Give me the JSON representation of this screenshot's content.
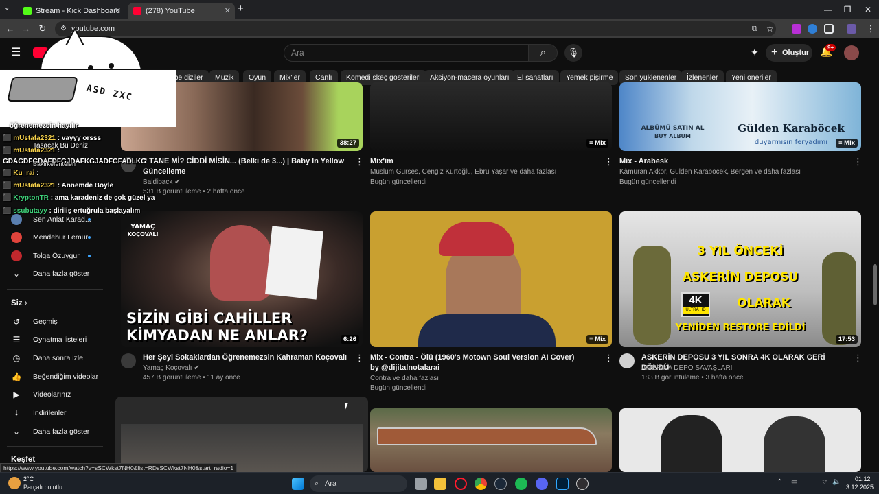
{
  "browser": {
    "tabs": [
      {
        "title": "Stream - Kick Dashboard",
        "favicon_color": "#53fc18"
      },
      {
        "title": "(278) YouTube",
        "favicon_color": "#ff0033"
      }
    ],
    "url": "youtube.com",
    "new_tab_label": "+"
  },
  "youtube": {
    "search_placeholder": "Ara",
    "create_label": "Oluştur",
    "notification_badge": "9+",
    "chips": [
      "Pembe diziler",
      "Müzik",
      "Oyun",
      "Mix'ler",
      "Canlı",
      "Komedi skeç gösterileri",
      "Aksiyon-macera oyunları",
      "El sanatları",
      "Yemek pişirme",
      "Son yüklenenler",
      "İzlenenler",
      "Yeni öneriler"
    ]
  },
  "sidebar": {
    "subscriptions": [
      {
        "label": "Sen Anlat Karad...",
        "color": "#5a7fb0"
      },
      {
        "label": "Mendebur Lemur",
        "color": "#e0443c"
      },
      {
        "label": "Tolga Özuygur",
        "color": "#c0282d"
      }
    ],
    "show_more": "Daha fazla göster",
    "you_section": "Siz",
    "you_items": [
      {
        "label": "Geçmiş",
        "icon": "history-icon",
        "glyph": "↺"
      },
      {
        "label": "Oynatma listeleri",
        "icon": "playlist-icon",
        "glyph": "☰"
      },
      {
        "label": "Daha sonra izle",
        "icon": "clock-icon",
        "glyph": "◷"
      },
      {
        "label": "Beğendiğim videolar",
        "icon": "thumbs-up-icon",
        "glyph": "👍"
      },
      {
        "label": "Videolarınız",
        "icon": "video-icon",
        "glyph": "▶"
      },
      {
        "label": "İndirilenler",
        "icon": "download-icon",
        "glyph": "⤓"
      }
    ],
    "show_more_2": "Daha fazla göster",
    "explore": "Keşfet"
  },
  "videos": [
    {
      "title": "2 TANE Mİ? CİDDİ MİSİN... (Belki de 3...) | Baby In Yellow Güncelleme",
      "channel": "Baldiback",
      "verified": true,
      "meta": "531 B görüntüleme • 2 hafta önce",
      "duration": "38:27"
    },
    {
      "title": "Mix'im",
      "channel": "Müslüm Gürses, Cengiz Kurtoğlu, Ebru Yaşar ve daha fazlası",
      "meta": "Bugün güncellendi",
      "duration": "Mix"
    },
    {
      "title": "Mix - Arabesk",
      "channel": "Kâmuran Akkor, Gülden Karaböcek, Bergen ve daha fazlası",
      "meta": "Bugün güncellendi",
      "duration": "Mix",
      "thumb_text": [
        "ALBÜMÜ SATIN AL",
        "BUY ALBUM",
        "Gülden Karaböcek",
        "duyarmısın feryadımı"
      ]
    },
    {
      "title": "Her Şeyi Sokaklardan Öğrenemezsin Kahraman Koçovalı",
      "channel": "Yamaç Koçovalı",
      "verified": true,
      "meta": "457 B görüntüleme • 11 ay önce",
      "duration": "6:26",
      "thumb_text": [
        "SİZİN GİBİ CAHİLLER",
        "KİMYADAN NE ANLAR?",
        "YAMAÇ",
        "KOÇOVALI"
      ]
    },
    {
      "title": "Mix - Contra - Ölü (1960's Motown Soul Version AI Cover) by @dijitalnotalarai",
      "channel": "Contra ve daha fazlası",
      "meta": "Bugün güncellendi",
      "duration": "Mix"
    },
    {
      "title": "ASKERİN DEPOSU 3 YIL SONRA 4K OLARAK GERİ DÖNDÜ",
      "channel": "AMERİKA DEPO SAVAŞLARI",
      "meta": "183 B görüntüleme • 3 hafta önce",
      "duration": "17:53",
      "thumb_text": [
        "3 YIL ÖNCEKİ",
        "ASKERİN DEPOSU",
        "OLARAK",
        "YENİDEN RESTORE EDİLDİ",
        "4K",
        "ULTRA HD"
      ]
    }
  ],
  "chat_overlay": [
    {
      "user": "",
      "text": "öğrenemezsin hayılır",
      "color": "#ffffff"
    },
    {
      "user": "mUstafa2321",
      "text": ": vayyy orsss",
      "color": "#f5d04a"
    },
    {
      "user": "",
      "text": "Taşacak Bu Deniz",
      "color": "#ffffff"
    },
    {
      "user": "mUstafa2321",
      "text": ":",
      "color": "#f5d04a"
    },
    {
      "user": "",
      "text": "GDAGDFGDAFDFGJDAFKGJADFGFADLKG",
      "color": "#ffffff"
    },
    {
      "user": "",
      "text": "Bakirkefenteleri",
      "color": "#ffffff"
    },
    {
      "user": "Ku_rai",
      "text": ":",
      "color": "#f5d04a"
    },
    {
      "user": "mUstafa2321",
      "text": ": Annemde Böyle",
      "color": "#f5d04a"
    },
    {
      "user": "KryptonTR",
      "text": ": ama karadeniz de çok güzel ya",
      "color": "#3fd17a"
    },
    {
      "user": "ssubutayy",
      "text": ": diriliş ertuğrula başlayalım",
      "color": "#3fd17a"
    }
  ],
  "overlay_keyboard_letters": "ASD ZXC",
  "status_url": "https://www.youtube.com/watch?v=sSCWkst7NH0&list=RDsSCWkst7NH0&start_radio=1",
  "taskbar": {
    "weather_temp": "2°C",
    "weather_desc": "Parçalı bulutlu",
    "search_label": "Ara",
    "time": "01:12",
    "date": "3.12.2025"
  }
}
